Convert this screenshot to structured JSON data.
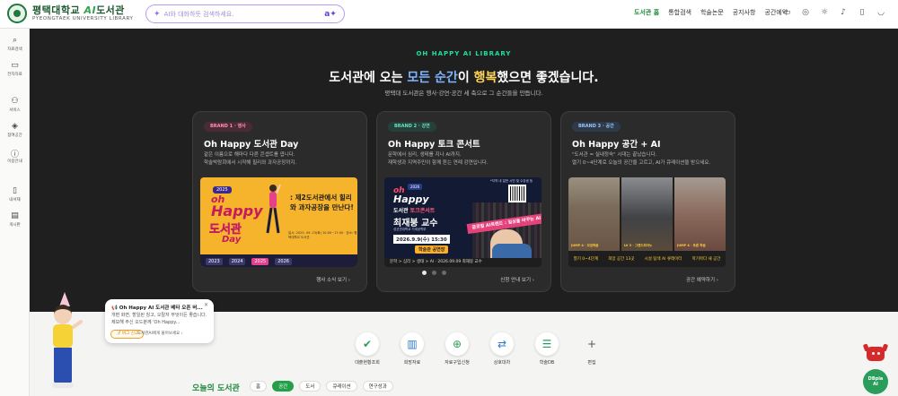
{
  "header": {
    "logo_title": "평택대학교",
    "logo_ai": "AI",
    "logo_title_suffix": "도서관",
    "logo_sub": "PYEONGTAEK UNIVERSITY LIBRARY",
    "search_placeholder": "AI와 대화하듯 검색하세요.",
    "nav": [
      "도서관 홈",
      "통합검색",
      "학술논문",
      "공지사항",
      "공간예약"
    ],
    "active_nav": "도서관 홈",
    "icons": [
      "translate-icon",
      "globe-icon",
      "theme-icon",
      "bell-icon",
      "bookmark-icon",
      "profile-icon"
    ]
  },
  "sidebar": {
    "items": [
      {
        "label": "자료검색",
        "icon": "search-icon"
      },
      {
        "label": "전자자료",
        "icon": "monitor-icon"
      },
      {
        "label": "서비스",
        "icon": "users-icon"
      },
      {
        "label": "참여공간",
        "icon": "layers-icon"
      },
      {
        "label": "이용안내",
        "icon": "info-icon"
      },
      {
        "label": "내서재",
        "icon": "bookshelf-icon"
      },
      {
        "label": "게시판",
        "icon": "board-icon"
      }
    ]
  },
  "hero": {
    "eyebrow": "OH HAPPY AI LIBRARY",
    "headline_prefix": "도서관에 오는 ",
    "headline_h1": "모든 순간",
    "headline_mid": "이 ",
    "headline_h2": "행복",
    "headline_suffix": "했으면 좋겠습니다.",
    "subline": "평택대 도서관은 행사·강연·공간 세 축으로 그 순간들을 만듭니다.",
    "cards": [
      {
        "badge": "BRAND 1 · 행사",
        "title": "Oh Happy 도서관 Day",
        "desc": [
          "같은 이름으로 해마다 다른 콘셉트를 엽니다.",
          "학술박람회에서 시작해 힐리와 과자공장까지."
        ],
        "link": "행사 소식 보기",
        "poster": {
          "year_tag": "2025",
          "oh": "oh",
          "happy": "Happy",
          "dsg": "도서관",
          "day": "Day",
          "quote": ": 제2도서관에서 힐리와 과자공장을 만난다!",
          "info": "일시: 2025. 09. 23(화) 10:00~17:00 · 장소: 평택대학교 도서관",
          "years": [
            "2023",
            "2024",
            "2025",
            "2026"
          ],
          "current_year": "2025"
        }
      },
      {
        "badge": "BRAND 2 · 강연",
        "title": "Oh Happy 토크 콘서트",
        "desc": [
          "문학에서 심리, 생태를 지나 AI까지.",
          "재학생과 지역주민이 함께 듣는 연례 강연입니다."
        ],
        "link": "신청 안내 보기",
        "poster": {
          "tag": "*지역 내 일반 시민 및 수강생 등",
          "year_tag": "2026",
          "oh": "oh",
          "happy": "Happy",
          "sub_prefix": "도서관 ",
          "sub_highlight": "토크콘서트",
          "professor": "최재붕 교수",
          "small": "성균관대학교 기계공학부",
          "date": "2026.9.9(수) 15:30",
          "place": "학술관 공연장",
          "ribbon": "글로벌 AI트렌드 : 일상을 바꾸는 AI",
          "caption": "문학 > 심리 > 생태 > AI · 2026.09.09 최재붕 교수"
        }
      },
      {
        "badge": "BRAND 3 · 공간",
        "title": "Oh Happy 공간 + AI",
        "desc": [
          "\"도서관 = 실내정숙\" 시대는 끝났습니다.",
          "열기 0~4단계로 오늘의 공간을 고르고, AI가 큐레이션을 받으세요."
        ],
        "link": "공간 예약하기",
        "photos": [
          "JUMP 4 · 모임학습",
          "LV 3 · 그랜드피아노",
          "JUMP 4 · 토론 학습"
        ],
        "chips": [
          "열기 0~4단계",
          "희망 공간 13곳",
          "시설 탐색 AI 큐레이터",
          "학기마다 새 공간"
        ]
      }
    ],
    "dots": 3,
    "active_dot": 0
  },
  "assistant": {
    "title": "Oh Happy AI 도서관 베타 오픈 버...",
    "body": "개편 화면, 할일된 칭고, 오탈자 무엇이든 좋습니다. 제보해 주신 오드분께 'Oh Happy...",
    "chip": "버그 신고",
    "ask": "도서관AI에게 물어보세요"
  },
  "shortcuts": [
    {
      "label": "대출현황조회",
      "icon": "check-shield-icon",
      "color": "#2a9d5a"
    },
    {
      "label": "희망자료",
      "icon": "open-book-icon",
      "color": "#2a7ac8"
    },
    {
      "label": "자료구입신청",
      "icon": "cart-plus-icon",
      "color": "#2a9d5a"
    },
    {
      "label": "상호대차",
      "icon": "exchange-icon",
      "color": "#2a7ac8"
    },
    {
      "label": "학술DB",
      "icon": "database-icon",
      "color": "#2a9d5a"
    },
    {
      "label": "편집",
      "icon": "plus-icon",
      "color": "#555555"
    }
  ],
  "today": {
    "title": "오늘의 도서관",
    "filters": [
      "홈",
      "공간",
      "도서",
      "큐레이션",
      "연구성과"
    ],
    "active": "공간"
  },
  "fab": {
    "line1": "DBpia",
    "line2": "AI"
  }
}
